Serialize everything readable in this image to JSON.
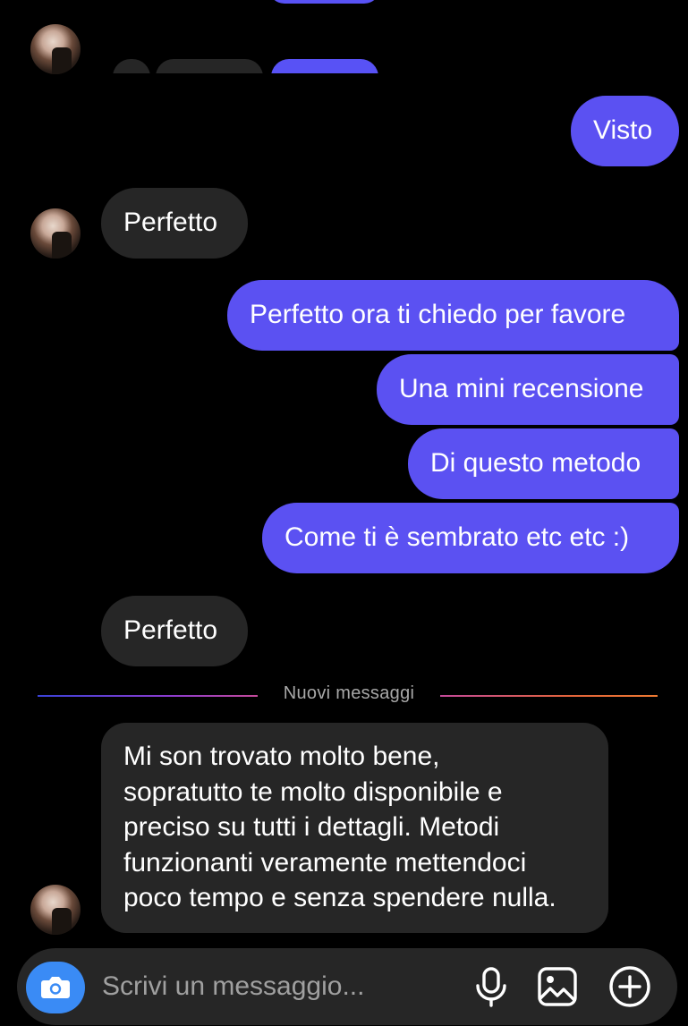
{
  "conversation": {
    "messages": [
      {
        "id": "m1",
        "direction": "outgoing",
        "text": "Visto"
      },
      {
        "id": "m2",
        "direction": "incoming",
        "text": "Perfetto"
      },
      {
        "id": "m3",
        "direction": "outgoing",
        "text": "Perfetto ora ti chiedo per favore"
      },
      {
        "id": "m4",
        "direction": "outgoing",
        "text": "Una mini recensione"
      },
      {
        "id": "m5",
        "direction": "outgoing",
        "text": "Di questo metodo"
      },
      {
        "id": "m6",
        "direction": "outgoing",
        "text": "Come ti è sembrato etc etc :)"
      },
      {
        "id": "m7",
        "direction": "incoming",
        "text": "Perfetto"
      }
    ],
    "new_messages_divider": "Nuovi messaggi",
    "long_message": {
      "lines": [
        "Mi son trovato molto bene,",
        "sopratutto te molto disponibile e",
        "preciso su tutti i dettagli. Metodi",
        "funzionanti veramente mettendoci",
        "poco tempo e senza spendere nulla."
      ]
    }
  },
  "composer": {
    "placeholder": "Scrivi un messaggio...",
    "icons": {
      "camera": "camera-icon",
      "mic": "microphone-icon",
      "gallery": "image-icon",
      "add": "plus-circle-icon"
    }
  },
  "colors": {
    "background": "#000000",
    "incoming_bubble": "#262626",
    "outgoing_bubble": "#5b51f2",
    "camera_button": "#3a8bf5",
    "divider_text": "#a8a8a8"
  }
}
